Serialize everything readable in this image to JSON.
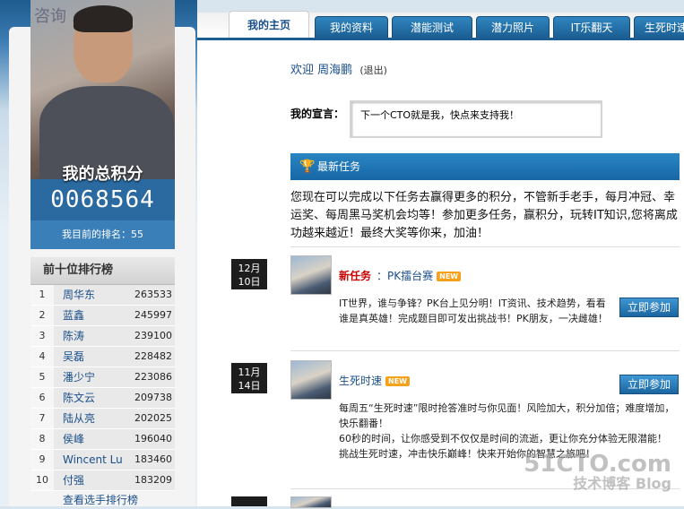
{
  "tabs": [
    {
      "label": "我的主页",
      "active": true
    },
    {
      "label": "我的资料",
      "active": false
    },
    {
      "label": "潜能测试",
      "active": false
    },
    {
      "label": "潜力照片",
      "active": false
    },
    {
      "label": "IT乐翻天",
      "active": false
    },
    {
      "label": "生死时速",
      "active": false
    }
  ],
  "profile": {
    "board_text": "咨询 ...",
    "score_label": "我的总积分",
    "score": "0068564",
    "rank_text": "我目前的排名：55"
  },
  "leaderboard": {
    "title": "前十位排行榜",
    "rows": [
      {
        "rank": "1",
        "name": "周华东",
        "points": "263533"
      },
      {
        "rank": "2",
        "name": "蓝鑫",
        "points": "245997"
      },
      {
        "rank": "3",
        "name": "陈涛",
        "points": "239100"
      },
      {
        "rank": "4",
        "name": "吴磊",
        "points": "228482"
      },
      {
        "rank": "5",
        "name": "潘少宁",
        "points": "223086"
      },
      {
        "rank": "6",
        "name": "陈文云",
        "points": "209738"
      },
      {
        "rank": "7",
        "name": "陆从亮",
        "points": "202025"
      },
      {
        "rank": "8",
        "name": "侯峰",
        "points": "196040"
      },
      {
        "rank": "9",
        "name": "Wincent Lu",
        "points": "183460"
      },
      {
        "rank": "10",
        "name": "付强",
        "points": "183209"
      }
    ],
    "more_link": "查看选手排行榜"
  },
  "welcome": {
    "prefix": "欢迎",
    "name": "周海鹏",
    "logout": "(退出)"
  },
  "declaration": {
    "label": "我的宣言：",
    "text": "下一个CTO就是我，快点来支持我！"
  },
  "tasks_header": "最新任务",
  "intro": "您现在可以完成以下任务去赢得更多的积分，不管新手老手，每月冲冠、幸运奖、每周黑马奖机会均等！参加更多任务，赢积分，玩转IT知识,您将离成功越来越近！最终大奖等你来，加油！",
  "items": [
    {
      "date_month": "12月",
      "date_day": "10日",
      "title": "新任务",
      "subtitle": "：PK擂台赛",
      "badge": "NEW",
      "desc": "IT世界，谁与争锋？PK台上见分明！IT资讯、技术趋势，看看谁是真英雄！完成题目即可发出挑战书！PK朋友，一决雌雄！",
      "button": "立即参加"
    },
    {
      "date_month": "11月",
      "date_day": "14日",
      "title": "生死时速",
      "badge": "NEW",
      "desc1": "每周五“生死时速”限时抢答准时与你见面！风险加大，积分加倍；难度增加，快乐翻番！",
      "desc2": "60秒的时间，让你感受到不仅仅是时间的流逝，更让你充分体验无限潜能！",
      "desc3": "挑战生死时速，冲击快乐巅峰！快来开始你的智慧之旅吧！",
      "button": "立即参加"
    }
  ],
  "watermark": {
    "line1": "51CTO.com",
    "line2": "技术博客  Blog"
  }
}
